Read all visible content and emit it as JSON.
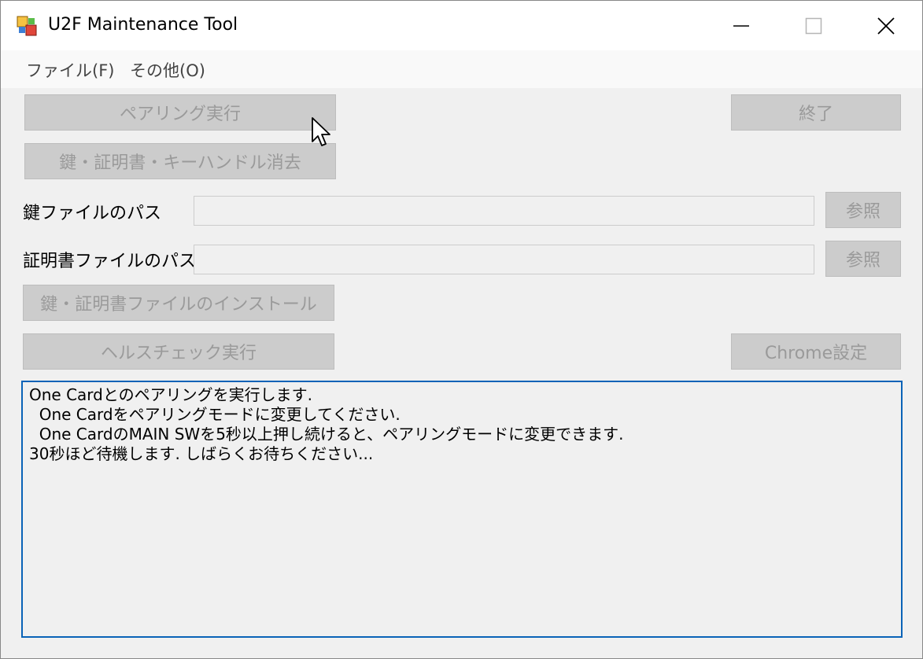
{
  "window": {
    "title": "U2F Maintenance Tool",
    "icon": "app-icon"
  },
  "menu": {
    "file": "ファイル(F)",
    "other": "その他(O)"
  },
  "buttons": {
    "pairing": "ペアリング実行",
    "exit": "終了",
    "erase": "鍵・証明書・キーハンドル消去",
    "browse_key": "参照",
    "browse_cert": "参照",
    "install": "鍵・証明書ファイルのインストール",
    "health_check": "ヘルスチェック実行",
    "chrome_settings": "Chrome設定"
  },
  "fields": {
    "key_path_label": "鍵ファイルのパス",
    "key_path_value": "",
    "cert_path_label": "証明書ファイルのパス",
    "cert_path_value": ""
  },
  "log": {
    "lines": [
      "One Cardとのペアリングを実行します.",
      "  One Cardをペアリングモードに変更してください.",
      "  One CardのMAIN SWを5秒以上押し続けると、ペアリングモードに変更できます.",
      "30秒ほど待機します. しばらくお待ちください..."
    ]
  },
  "colors": {
    "button_disabled_bg": "#cccccc",
    "button_disabled_text": "#9a9a9a",
    "log_border": "#0a63b7",
    "window_bg": "#f0f0f0"
  }
}
